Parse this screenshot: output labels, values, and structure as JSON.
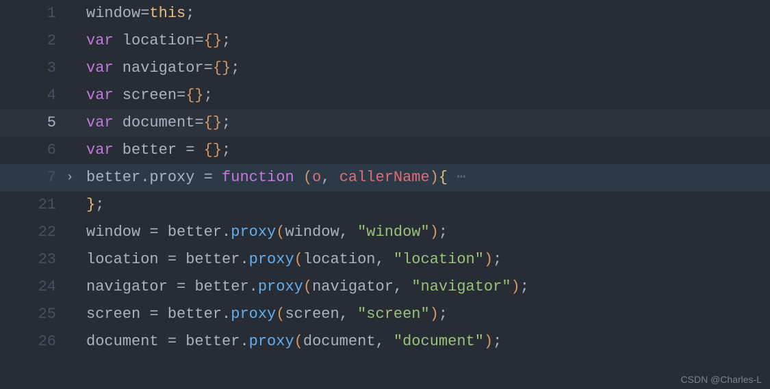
{
  "lines": [
    {
      "num": "1",
      "fold": "",
      "hl": false,
      "cur": false,
      "active": false,
      "tokens": [
        [
          "tk-ident",
          "window"
        ],
        [
          "tk-op",
          "="
        ],
        [
          "tk-this",
          "this"
        ],
        [
          "tk-semi",
          ";"
        ]
      ]
    },
    {
      "num": "2",
      "fold": "",
      "hl": false,
      "cur": false,
      "active": false,
      "tokens": [
        [
          "tk-keyword",
          "var"
        ],
        [
          "tk-ident",
          " location"
        ],
        [
          "tk-op",
          "="
        ],
        [
          "tk-brace",
          "{}"
        ],
        [
          "tk-semi",
          ";"
        ]
      ]
    },
    {
      "num": "3",
      "fold": "",
      "hl": false,
      "cur": false,
      "active": false,
      "tokens": [
        [
          "tk-keyword",
          "var"
        ],
        [
          "tk-ident",
          " navigator"
        ],
        [
          "tk-op",
          "="
        ],
        [
          "tk-brace",
          "{}"
        ],
        [
          "tk-semi",
          ";"
        ]
      ]
    },
    {
      "num": "4",
      "fold": "",
      "hl": false,
      "cur": false,
      "active": false,
      "tokens": [
        [
          "tk-keyword",
          "var"
        ],
        [
          "tk-ident",
          " screen"
        ],
        [
          "tk-op",
          "="
        ],
        [
          "tk-brace",
          "{}"
        ],
        [
          "tk-semi",
          ";"
        ]
      ]
    },
    {
      "num": "5",
      "fold": "",
      "hl": true,
      "cur": false,
      "active": true,
      "tokens": [
        [
          "tk-keyword",
          "var"
        ],
        [
          "tk-ident",
          " document"
        ],
        [
          "tk-op",
          "="
        ],
        [
          "tk-brace",
          "{}"
        ],
        [
          "tk-semi",
          ";"
        ]
      ]
    },
    {
      "num": "6",
      "fold": "",
      "hl": false,
      "cur": false,
      "active": false,
      "tokens": [
        [
          "tk-keyword",
          "var"
        ],
        [
          "tk-ident",
          " better "
        ],
        [
          "tk-op",
          "= "
        ],
        [
          "tk-brace",
          "{}"
        ],
        [
          "tk-semi",
          ";"
        ]
      ]
    },
    {
      "num": "7",
      "fold": "›",
      "hl": false,
      "cur": true,
      "active": false,
      "tokens": [
        [
          "tk-ident",
          "better"
        ],
        [
          "tk-op",
          "."
        ],
        [
          "tk-prop",
          "proxy "
        ],
        [
          "tk-op",
          "= "
        ],
        [
          "tk-func",
          "function"
        ],
        [
          "tk-ident",
          " "
        ],
        [
          "tk-paren-y",
          "("
        ],
        [
          "tk-param",
          "o"
        ],
        [
          "tk-ident",
          ", "
        ],
        [
          "tk-param",
          "callerName"
        ],
        [
          "tk-paren-y",
          ")"
        ],
        [
          "tk-brace-y",
          "{"
        ],
        [
          "tk-dots",
          " ⋯"
        ]
      ]
    },
    {
      "num": "21",
      "fold": "",
      "hl": false,
      "cur": false,
      "active": false,
      "tokens": [
        [
          "tk-brace-y",
          "}"
        ],
        [
          "tk-semi",
          ";"
        ]
      ]
    },
    {
      "num": "22",
      "fold": "",
      "hl": false,
      "cur": false,
      "active": false,
      "tokens": [
        [
          "tk-ident",
          "window "
        ],
        [
          "tk-op",
          "= "
        ],
        [
          "tk-ident",
          "better"
        ],
        [
          "tk-op",
          "."
        ],
        [
          "tk-call",
          "proxy"
        ],
        [
          "tk-paren-y",
          "("
        ],
        [
          "tk-ident",
          "window"
        ],
        [
          "tk-ident",
          ", "
        ],
        [
          "tk-str",
          "\"window\""
        ],
        [
          "tk-paren-y",
          ")"
        ],
        [
          "tk-semi",
          ";"
        ]
      ]
    },
    {
      "num": "23",
      "fold": "",
      "hl": false,
      "cur": false,
      "active": false,
      "tokens": [
        [
          "tk-ident",
          "location "
        ],
        [
          "tk-op",
          "= "
        ],
        [
          "tk-ident",
          "better"
        ],
        [
          "tk-op",
          "."
        ],
        [
          "tk-call",
          "proxy"
        ],
        [
          "tk-paren-y",
          "("
        ],
        [
          "tk-ident",
          "location"
        ],
        [
          "tk-ident",
          ", "
        ],
        [
          "tk-str",
          "\"location\""
        ],
        [
          "tk-paren-y",
          ")"
        ],
        [
          "tk-semi",
          ";"
        ]
      ]
    },
    {
      "num": "24",
      "fold": "",
      "hl": false,
      "cur": false,
      "active": false,
      "tokens": [
        [
          "tk-ident",
          "navigator "
        ],
        [
          "tk-op",
          "= "
        ],
        [
          "tk-ident",
          "better"
        ],
        [
          "tk-op",
          "."
        ],
        [
          "tk-call",
          "proxy"
        ],
        [
          "tk-paren-y",
          "("
        ],
        [
          "tk-ident",
          "navigator"
        ],
        [
          "tk-ident",
          ", "
        ],
        [
          "tk-str",
          "\"navigator\""
        ],
        [
          "tk-paren-y",
          ")"
        ],
        [
          "tk-semi",
          ";"
        ]
      ]
    },
    {
      "num": "25",
      "fold": "",
      "hl": false,
      "cur": false,
      "active": false,
      "tokens": [
        [
          "tk-ident",
          "screen "
        ],
        [
          "tk-op",
          "= "
        ],
        [
          "tk-ident",
          "better"
        ],
        [
          "tk-op",
          "."
        ],
        [
          "tk-call",
          "proxy"
        ],
        [
          "tk-paren-y",
          "("
        ],
        [
          "tk-ident",
          "screen"
        ],
        [
          "tk-ident",
          ", "
        ],
        [
          "tk-str",
          "\"screen\""
        ],
        [
          "tk-paren-y",
          ")"
        ],
        [
          "tk-semi",
          ";"
        ]
      ]
    },
    {
      "num": "26",
      "fold": "",
      "hl": false,
      "cur": false,
      "active": false,
      "tokens": [
        [
          "tk-ident",
          "document "
        ],
        [
          "tk-op",
          "= "
        ],
        [
          "tk-ident",
          "better"
        ],
        [
          "tk-op",
          "."
        ],
        [
          "tk-call",
          "proxy"
        ],
        [
          "tk-paren-y",
          "("
        ],
        [
          "tk-ident",
          "document"
        ],
        [
          "tk-ident",
          ", "
        ],
        [
          "tk-str",
          "\"document\""
        ],
        [
          "tk-paren-y",
          ")"
        ],
        [
          "tk-semi",
          ";"
        ]
      ]
    }
  ],
  "watermark": "CSDN @Charles-L"
}
